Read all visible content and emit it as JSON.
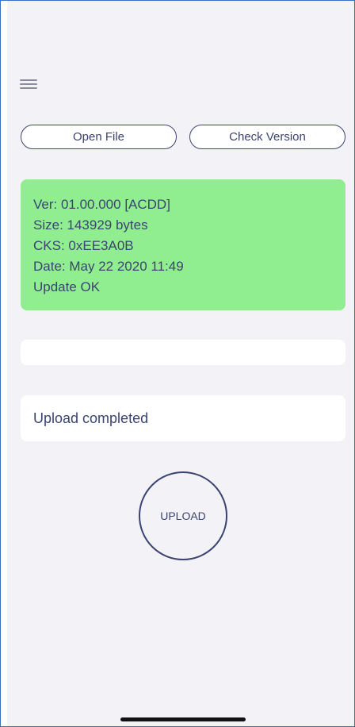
{
  "toolbar": {
    "menu_icon": "hamburger-menu-icon",
    "open_file_label": "Open File",
    "check_version_label": "Check Version"
  },
  "firmware_info": {
    "version": "Ver: 01.00.000 [ACDD]",
    "size": "Size: 143929 bytes",
    "checksum": "CKS: 0xEE3A0B",
    "date": "Date: May 22 2020 11:49",
    "status": "Update OK",
    "background_color": "#90ee90"
  },
  "progress": {
    "value": 0
  },
  "upload_status": {
    "text": "Upload completed"
  },
  "upload_button": {
    "label": "UPLOAD"
  },
  "colors": {
    "accent": "#3b4470",
    "background": "#f2f2f7",
    "success": "#90ee90"
  }
}
